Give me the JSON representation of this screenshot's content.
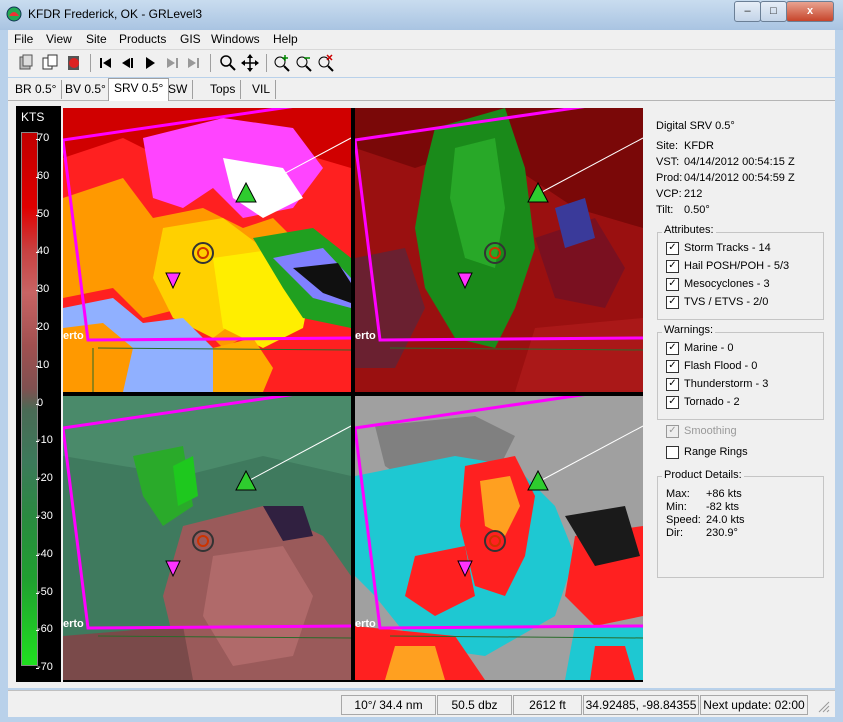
{
  "window": {
    "title": "KFDR Frederick, OK - GRLevel3",
    "close": "x",
    "min": "–",
    "max": "□"
  },
  "menu": [
    "File",
    "View",
    "Site",
    "Products",
    "GIS",
    "Windows",
    "Help"
  ],
  "toolbar_icons": [
    "copy-icon",
    "copy-all-icon",
    "exit-icon",
    "first-frame-icon",
    "previous-frame-icon",
    "play-icon",
    "next-frame-icon",
    "last-frame-icon",
    "zoom-icon",
    "pan-icon",
    "zoom-in-icon",
    "zoom-out-icon",
    "zoom-reset-icon"
  ],
  "tabs": [
    "BR 0.5°",
    "BV 0.5°",
    "SRV 0.5°",
    "SW",
    "Tops",
    "VIL"
  ],
  "active_tab": "SRV 0.5°",
  "legend": {
    "unit": "KTS",
    "values": [
      "70",
      "60",
      "50",
      "40",
      "30",
      "20",
      "10",
      "0",
      "-10",
      "-20",
      "-30",
      "-40",
      "-50",
      "-60",
      "-70"
    ]
  },
  "pane_label": "erto",
  "info": {
    "product": "Digital SRV 0.5°",
    "site_label": "Site:",
    "site": "KFDR",
    "vst_label": "VST:",
    "vst": "04/14/2012  00:54:15 Z",
    "prod_label": "Prod:",
    "prod": "04/14/2012  00:54:59 Z",
    "vcp_label": "VCP:",
    "vcp": "212",
    "tilt_label": "Tilt:",
    "tilt": "0.50°"
  },
  "attributes": {
    "title": "Attributes:",
    "items": [
      "Storm Tracks - 14",
      "Hail POSH/POH - 5/3",
      "Mesocyclones - 3",
      "TVS / ETVS - 2/0"
    ]
  },
  "warnings": {
    "title": "Warnings:",
    "items": [
      "Marine - 0",
      "Flash Flood - 0",
      "Thunderstorm - 3",
      "Tornado - 2"
    ]
  },
  "smoothing": "Smoothing",
  "range_rings": "Range Rings",
  "details": {
    "title": "Product Details:",
    "max_label": "Max:",
    "max": "+86 kts",
    "min_label": "Min:",
    "min": "-82 kts",
    "speed_label": "Speed:",
    "speed": "24.0 kts",
    "dir_label": "Dir:",
    "dir": "230.9°"
  },
  "status": {
    "azran": "10°/ 34.4 nm",
    "dbz": "50.5 dbz",
    "height": "2612 ft",
    "latlon": "34.92485, -98.84355",
    "next_update": "Next update: 02:00"
  },
  "colors": {
    "storm_track": "#2ecc2e",
    "meso": "#ff33ff",
    "warning_outline": "#ff00ff"
  }
}
